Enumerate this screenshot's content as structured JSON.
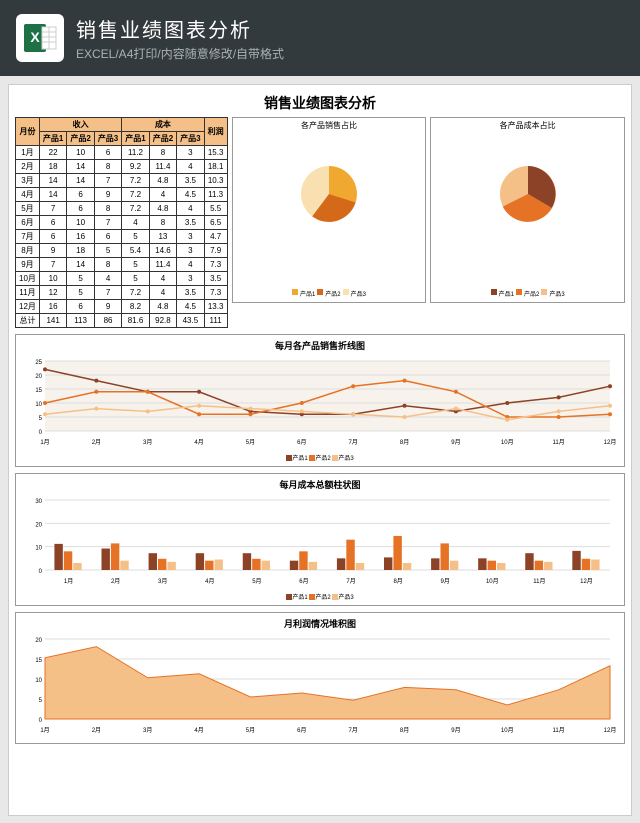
{
  "header": {
    "title": "销售业绩图表分析",
    "subtitle": "EXCEL/A4打印/内容随意修改/自带格式"
  },
  "sheet_title": "销售业绩图表分析",
  "columns": {
    "month": "月份",
    "group1": "收入",
    "group2": "成本",
    "profit": "利润",
    "p1": "产品1",
    "p2": "产品2",
    "p3": "产品3",
    "total": "总计"
  },
  "table": [
    {
      "m": "1月",
      "r1": 22,
      "r2": 10,
      "r3": 6,
      "c1": 11.2,
      "c2": 8,
      "c3": 3,
      "p": 15.3
    },
    {
      "m": "2月",
      "r1": 18,
      "r2": 14,
      "r3": 8,
      "c1": 9.2,
      "c2": 11.4,
      "c3": 4,
      "p": 18.1
    },
    {
      "m": "3月",
      "r1": 14,
      "r2": 14,
      "r3": 7,
      "c1": 7.2,
      "c2": 4.8,
      "c3": 3.5,
      "p": 10.3
    },
    {
      "m": "4月",
      "r1": 14,
      "r2": 6,
      "r3": 9,
      "c1": 7.2,
      "c2": 4,
      "c3": 4.5,
      "p": 11.3
    },
    {
      "m": "5月",
      "r1": 7,
      "r2": 6,
      "r3": 8,
      "c1": 7.2,
      "c2": 4.8,
      "c3": 4,
      "p": 5.5
    },
    {
      "m": "6月",
      "r1": 6,
      "r2": 10,
      "r3": 7,
      "c1": 4,
      "c2": 8,
      "c3": 3.5,
      "p": 6.5
    },
    {
      "m": "7月",
      "r1": 6,
      "r2": 16,
      "r3": 6,
      "c1": 5,
      "c2": 13,
      "c3": 3,
      "p": 4.7
    },
    {
      "m": "8月",
      "r1": 9,
      "r2": 18,
      "r3": 5,
      "c1": 5.4,
      "c2": 14.6,
      "c3": 3,
      "p": 7.9
    },
    {
      "m": "9月",
      "r1": 7,
      "r2": 14,
      "r3": 8,
      "c1": 5,
      "c2": 11.4,
      "c3": 4,
      "p": 7.3
    },
    {
      "m": "10月",
      "r1": 10,
      "r2": 5,
      "r3": 4,
      "c1": 5,
      "c2": 4,
      "c3": 3,
      "p": 3.5
    },
    {
      "m": "11月",
      "r1": 12,
      "r2": 5,
      "r3": 7,
      "c1": 7.2,
      "c2": 4,
      "c3": 3.5,
      "p": 7.3
    },
    {
      "m": "12月",
      "r1": 16,
      "r2": 6,
      "r3": 9,
      "c1": 8.2,
      "c2": 4.8,
      "c3": 4.5,
      "p": 13.3
    }
  ],
  "totals": {
    "m": "总计",
    "r1": 141,
    "r2": 113,
    "r3": 86,
    "c1": 81.6,
    "c2": 92.8,
    "c3": 43.5,
    "p": 111
  },
  "pie1": {
    "title": "各产品销售占比"
  },
  "pie2": {
    "title": "各产品成本占比"
  },
  "charts": {
    "line": {
      "title": "每月各产品销售折线图"
    },
    "bar": {
      "title": "每月成本总额柱状图"
    },
    "area": {
      "title": "月利润情况堆积图"
    }
  },
  "colors": {
    "p1": "#8b4226",
    "p2": "#e67225",
    "p3": "#f5c088",
    "alt1": "#f0a830",
    "alt2": "#d4691a",
    "alt3": "#f8e0b0"
  },
  "chart_data": [
    {
      "type": "pie",
      "title": "各产品销售占比",
      "series": [
        {
          "name": "产品1",
          "value": 141
        },
        {
          "name": "产品2",
          "value": 113
        },
        {
          "name": "产品3",
          "value": 86
        }
      ]
    },
    {
      "type": "pie",
      "title": "各产品成本占比",
      "series": [
        {
          "name": "产品1",
          "value": 81.6
        },
        {
          "name": "产品2",
          "value": 92.8
        },
        {
          "name": "产品3",
          "value": 43.5
        }
      ]
    },
    {
      "type": "line",
      "title": "每月各产品销售折线图",
      "categories": [
        "1月",
        "2月",
        "3月",
        "4月",
        "5月",
        "6月",
        "7月",
        "8月",
        "9月",
        "10月",
        "11月",
        "12月"
      ],
      "series": [
        {
          "name": "产品1",
          "values": [
            22,
            18,
            14,
            14,
            7,
            6,
            6,
            9,
            7,
            10,
            12,
            16
          ]
        },
        {
          "name": "产品2",
          "values": [
            10,
            14,
            14,
            6,
            6,
            10,
            16,
            18,
            14,
            5,
            5,
            6
          ]
        },
        {
          "name": "产品3",
          "values": [
            6,
            8,
            7,
            9,
            8,
            7,
            6,
            5,
            8,
            4,
            7,
            9
          ]
        }
      ],
      "ylim": [
        0,
        25
      ]
    },
    {
      "type": "bar",
      "title": "每月成本总额柱状图",
      "categories": [
        "1月",
        "2月",
        "3月",
        "4月",
        "5月",
        "6月",
        "7月",
        "8月",
        "9月",
        "10月",
        "11月",
        "12月"
      ],
      "series": [
        {
          "name": "产品1",
          "values": [
            11.2,
            9.2,
            7.2,
            7.2,
            7.2,
            4,
            5,
            5.4,
            5,
            5,
            7.2,
            8.2
          ]
        },
        {
          "name": "产品2",
          "values": [
            8,
            11.4,
            4.8,
            4,
            4.8,
            8,
            13,
            14.6,
            11.4,
            4,
            4,
            4.8
          ]
        },
        {
          "name": "产品3",
          "values": [
            3,
            4,
            3.5,
            4.5,
            4,
            3.5,
            3,
            3,
            4,
            3,
            3.5,
            4.5
          ]
        }
      ],
      "ylim": [
        0,
        30
      ]
    },
    {
      "type": "area",
      "title": "月利润情况堆积图",
      "categories": [
        "1月",
        "2月",
        "3月",
        "4月",
        "5月",
        "6月",
        "7月",
        "8月",
        "9月",
        "10月",
        "11月",
        "12月"
      ],
      "values": [
        15.3,
        18.1,
        10.3,
        11.3,
        5.5,
        6.5,
        4.7,
        7.9,
        7.3,
        3.5,
        7.3,
        13.3
      ],
      "ylim": [
        0,
        20
      ]
    }
  ]
}
